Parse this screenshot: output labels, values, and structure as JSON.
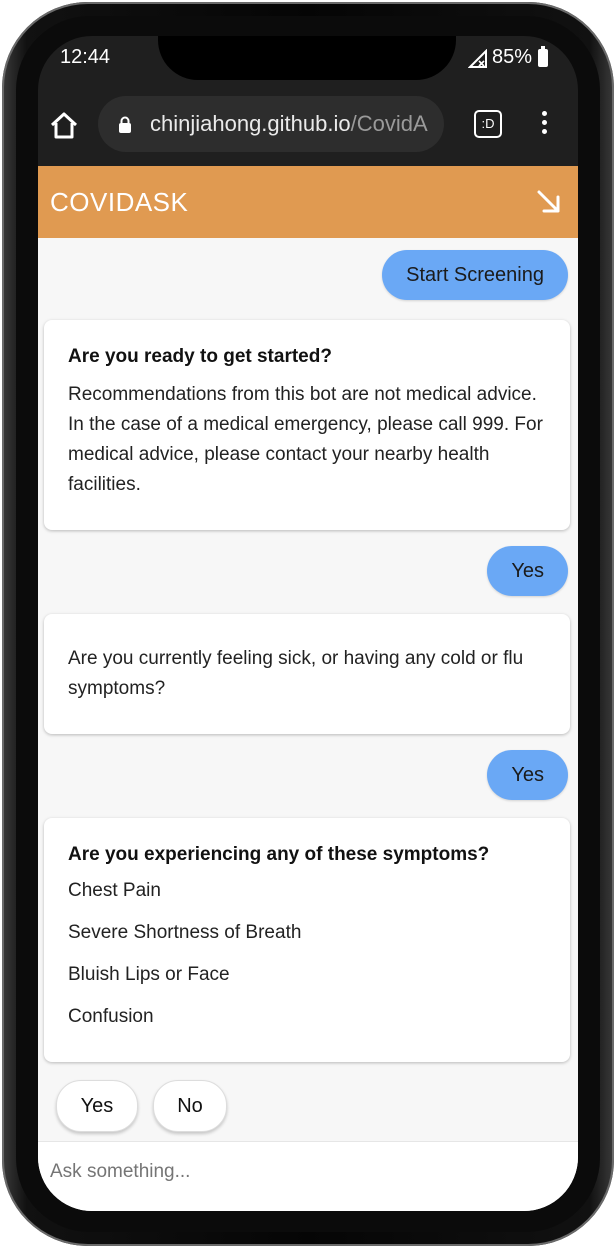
{
  "status_bar": {
    "time": "12:44",
    "battery": "85%"
  },
  "browser": {
    "url_host": "chinjiahong.github.io",
    "url_path": "/CovidA",
    "tab_icon_text": ":D"
  },
  "app": {
    "title": "COVIDASK"
  },
  "chat": {
    "user_msg_1": "Start Screening",
    "card_1": {
      "title": "Are you ready to get started?",
      "body": "Recommendations from this bot are not medical advice. In the case of a medical emergency, please call 999. For medical advice, please contact your nearby health facilities."
    },
    "user_msg_2": "Yes",
    "card_2": {
      "body": "Are you currently feeling sick, or having any cold or flu symptoms?"
    },
    "user_msg_3": "Yes",
    "card_3": {
      "title": "Are you experiencing any of these symptoms?",
      "options": [
        "Chest Pain",
        "Severe Shortness of Breath",
        "Bluish Lips or Face",
        "Confusion"
      ]
    },
    "quick_replies": [
      "Yes",
      "No"
    ]
  },
  "input": {
    "placeholder": "Ask something..."
  }
}
